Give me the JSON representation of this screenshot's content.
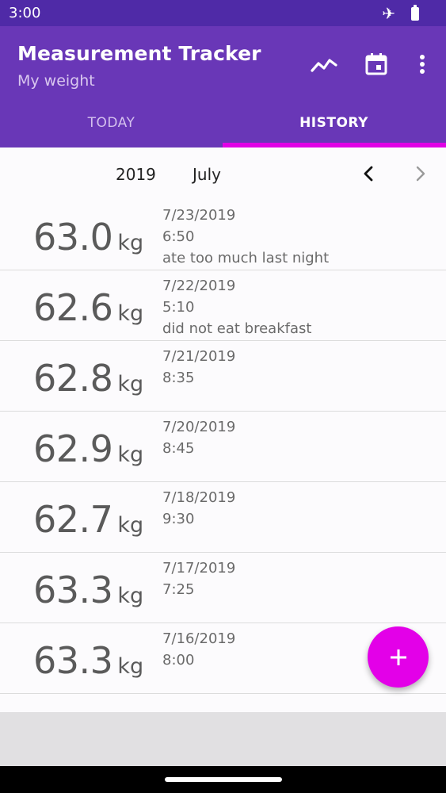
{
  "status_bar": {
    "time": "3:00"
  },
  "app_bar": {
    "title": "Measurement Tracker",
    "subtitle": "My weight",
    "icons": [
      "trending-chart-icon",
      "calendar-icon",
      "more-vert-icon"
    ]
  },
  "tabs": [
    {
      "label": "TODAY",
      "selected": false
    },
    {
      "label": "HISTORY",
      "selected": true
    }
  ],
  "month_selector": {
    "year": "2019",
    "month": "July"
  },
  "entries": [
    {
      "weight": "63.0",
      "unit": "kg",
      "date": "7/23/2019",
      "time": "6:50",
      "note": "ate too much last night"
    },
    {
      "weight": "62.6",
      "unit": "kg",
      "date": "7/22/2019",
      "time": "5:10",
      "note": "did not eat breakfast"
    },
    {
      "weight": "62.8",
      "unit": "kg",
      "date": "7/21/2019",
      "time": "8:35",
      "note": ""
    },
    {
      "weight": "62.9",
      "unit": "kg",
      "date": "7/20/2019",
      "time": "8:45",
      "note": ""
    },
    {
      "weight": "62.7",
      "unit": "kg",
      "date": "7/18/2019",
      "time": "9:30",
      "note": ""
    },
    {
      "weight": "63.3",
      "unit": "kg",
      "date": "7/17/2019",
      "time": "7:25",
      "note": ""
    },
    {
      "weight": "63.3",
      "unit": "kg",
      "date": "7/16/2019",
      "time": "8:00",
      "note": ""
    }
  ],
  "fab": {
    "icon": "add-icon"
  },
  "colors": {
    "status_bar": "#4f2aa7",
    "app_bar": "#6937b7",
    "accent": "#e300e8"
  }
}
